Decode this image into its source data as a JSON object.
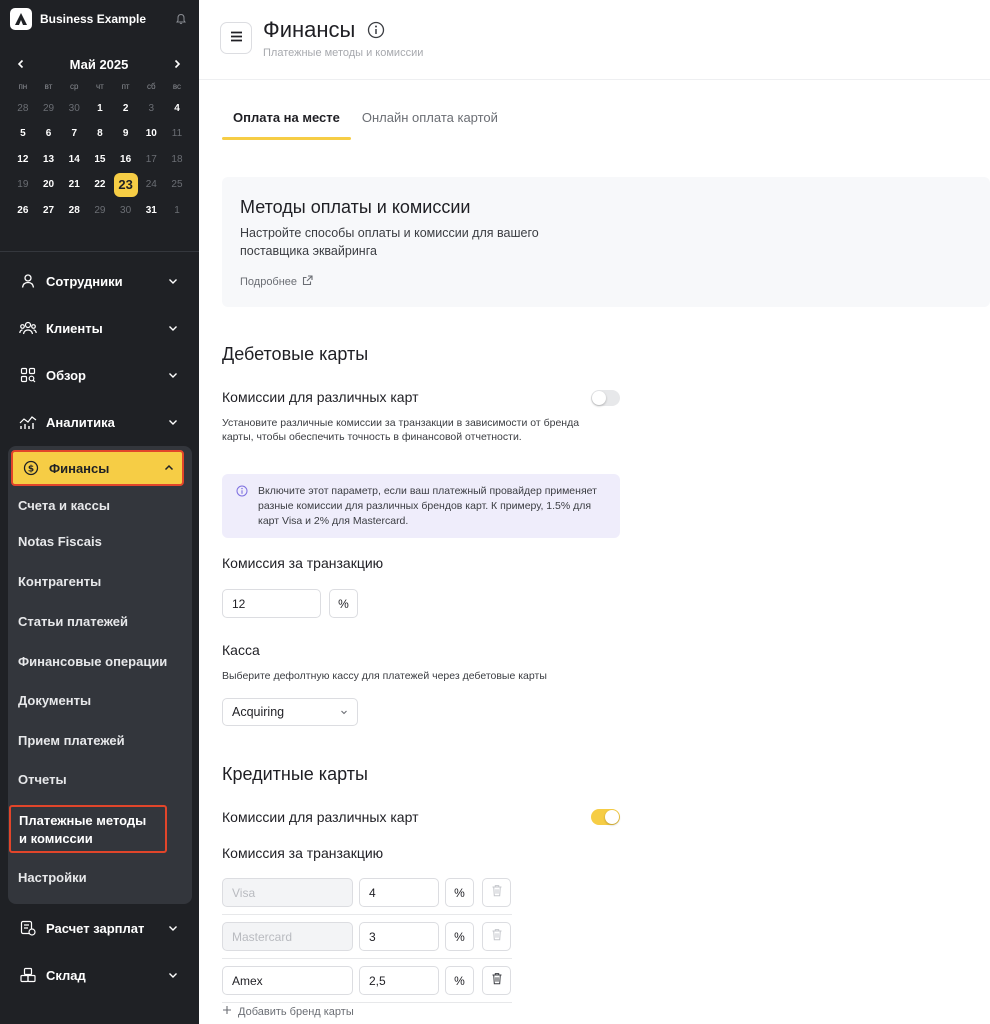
{
  "app": {
    "business_name": "Business Example"
  },
  "calendar": {
    "month_title": "Май 2025",
    "weekdays": [
      "пн",
      "вт",
      "ср",
      "чт",
      "пт",
      "сб",
      "вс"
    ],
    "weeks": [
      [
        {
          "d": "28",
          "m": true
        },
        {
          "d": "29",
          "m": true
        },
        {
          "d": "30",
          "m": true
        },
        {
          "d": "1"
        },
        {
          "d": "2"
        },
        {
          "d": "3",
          "m": true
        },
        {
          "d": "4"
        }
      ],
      [
        {
          "d": "5"
        },
        {
          "d": "6"
        },
        {
          "d": "7"
        },
        {
          "d": "8"
        },
        {
          "d": "9"
        },
        {
          "d": "10"
        },
        {
          "d": "11",
          "m": true
        }
      ],
      [
        {
          "d": "12"
        },
        {
          "d": "13"
        },
        {
          "d": "14"
        },
        {
          "d": "15"
        },
        {
          "d": "16"
        },
        {
          "d": "17",
          "m": true
        },
        {
          "d": "18",
          "m": true
        }
      ],
      [
        {
          "d": "19",
          "m": true
        },
        {
          "d": "20"
        },
        {
          "d": "21"
        },
        {
          "d": "22"
        },
        {
          "d": "23",
          "today": true
        },
        {
          "d": "24",
          "m": true
        },
        {
          "d": "25",
          "m": true
        }
      ],
      [
        {
          "d": "26"
        },
        {
          "d": "27"
        },
        {
          "d": "28"
        },
        {
          "d": "29",
          "m": true
        },
        {
          "d": "30",
          "m": true
        },
        {
          "d": "31"
        },
        {
          "d": "1",
          "m": true
        }
      ]
    ]
  },
  "nav": {
    "employees": "Сотрудники",
    "clients": "Клиенты",
    "overview": "Обзор",
    "analytics": "Аналитика",
    "finance": "Финансы",
    "payroll": "Расчет зарплат",
    "warehouse": "Склад",
    "finance_sub": {
      "accounts": "Счета и кассы",
      "notas": "Notas Fiscais",
      "counterparties": "Контрагенты",
      "payment_items": "Статьи платежей",
      "operations": "Финансовые операции",
      "documents": "Документы",
      "payment_accept": "Прием платежей",
      "reports": "Отчеты",
      "methods": "Платежные методы и комиссии",
      "settings": "Настройки"
    }
  },
  "header": {
    "title": "Финансы",
    "subtitle": "Платежные методы и комиссии"
  },
  "tabs": {
    "onsite": "Оплата на месте",
    "online": "Онлайн оплата картой"
  },
  "intro": {
    "title": "Методы оплаты и комиссии",
    "text": "Настройте способы оплаты и комиссии для вашего поставщика эквайринга",
    "more": "Подробнее"
  },
  "debit": {
    "title": "Дебетовые карты",
    "brand_fees_label": "Комиссии для различных карт",
    "brand_fees_enabled": false,
    "brand_fees_desc": "Установите различные комиссии за транзакции в зависимости от бренда карты, чтобы обеспечить точность в финансовой отчетности.",
    "hint": "Включите этот параметр, если ваш платежный провайдер применяет разные комиссии для различных брендов карт. К примеру, 1.5% для карт Visa и 2% для Mastercard.",
    "fee_label": "Комиссия за транзакцию",
    "fee_value": "12",
    "fee_unit": "%",
    "cashbox_label": "Касса",
    "cashbox_desc": "Выберите дефолтную кассу для платежей через дебетовые карты",
    "cashbox_value": "Acquiring"
  },
  "credit": {
    "title": "Кредитные карты",
    "brand_fees_label": "Комиссии для различных карт",
    "brand_fees_enabled": true,
    "fee_label": "Комиссия за транзакцию",
    "rows": [
      {
        "brand": "Visa",
        "value": "4",
        "unit": "%",
        "locked": true
      },
      {
        "brand": "Mastercard",
        "value": "3",
        "unit": "%",
        "locked": true
      },
      {
        "brand": "Amex",
        "value": "2,5",
        "unit": "%",
        "locked": false
      }
    ],
    "add_brand": "Добавить бренд карты"
  },
  "colors": {
    "accent": "#f6cd45",
    "highlight": "#e2452a",
    "sidebar": "#1f2125"
  }
}
